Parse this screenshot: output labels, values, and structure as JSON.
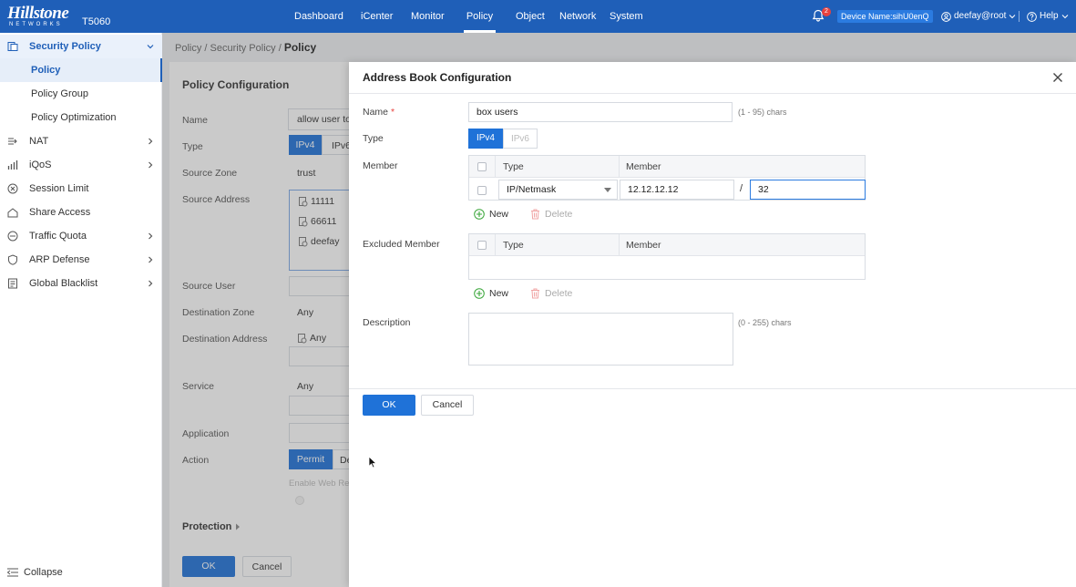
{
  "header": {
    "logo_text": "Hillstone",
    "logo_sub": "NETWORKS",
    "model": "T5060",
    "nav": [
      "Dashboard",
      "iCenter",
      "Monitor",
      "Policy",
      "Object",
      "Network",
      "System"
    ],
    "active_nav": "Policy",
    "notification_count": "2",
    "device_name": "Device Name:sihU0enQ",
    "user": "deefay@root",
    "help": "Help"
  },
  "sidebar": {
    "security_policy": "Security Policy",
    "sub_items": [
      "Policy",
      "Policy Group",
      "Policy Optimization"
    ],
    "items": [
      "NAT",
      "iQoS",
      "Session Limit",
      "Share Access",
      "Traffic Quota",
      "ARP Defense",
      "Global Blacklist"
    ],
    "collapse": "Collapse"
  },
  "breadcrumb": {
    "part1": "Policy / Security Policy / ",
    "current": "Policy"
  },
  "policy_config": {
    "title": "Policy Configuration",
    "name_label": "Name",
    "name_value": "allow user to",
    "type_label": "Type",
    "type_ipv4": "IPv4",
    "type_ipv6": "IPv6",
    "source_zone_label": "Source Zone",
    "source_zone_value": "trust",
    "source_address_label": "Source Address",
    "source_addresses": [
      "11111",
      "66611",
      "deefay"
    ],
    "source_user_label": "Source User",
    "destination_zone_label": "Destination Zone",
    "destination_zone_value": "Any",
    "destination_address_label": "Destination Address",
    "destination_address_value": "Any",
    "service_label": "Service",
    "service_value": "Any",
    "application_label": "Application",
    "action_label": "Action",
    "action_permit": "Permit",
    "action_deny": "De",
    "enable_web": "Enable Web Re",
    "protection": "Protection",
    "ok": "OK",
    "cancel": "Cancel"
  },
  "dialog": {
    "title": "Address Book Configuration",
    "name_label": "Name",
    "name_required": "*",
    "name_value": "box users",
    "name_hint": "(1 - 95) chars",
    "type_label": "Type",
    "type_ipv4": "IPv4",
    "type_ipv6": "IPv6",
    "member_label": "Member",
    "col_type": "Type",
    "col_member": "Member",
    "member_row": {
      "type": "IP/Netmask",
      "ip": "12.12.12.12",
      "separator": "/",
      "mask": "32"
    },
    "new_label": "New",
    "delete_label": "Delete",
    "excluded_label": "Excluded Member",
    "description_label": "Description",
    "description_hint": "(0 - 255) chars",
    "ok": "OK",
    "cancel": "Cancel"
  }
}
